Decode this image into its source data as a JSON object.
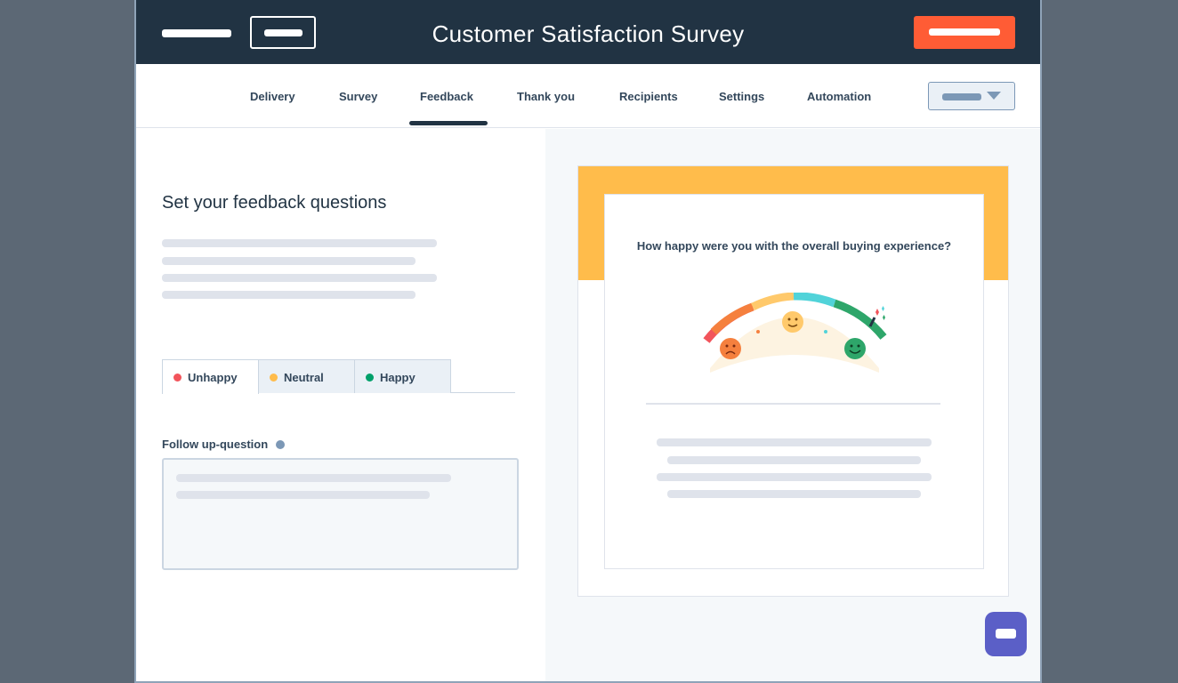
{
  "header": {
    "title": "Customer Satisfaction Survey"
  },
  "tabs": [
    {
      "label": "Delivery"
    },
    {
      "label": "Survey"
    },
    {
      "label": "Feedback",
      "active": true
    },
    {
      "label": "Thank you"
    },
    {
      "label": "Recipients"
    },
    {
      "label": "Settings"
    },
    {
      "label": "Automation"
    }
  ],
  "editor": {
    "section_title": "Set your feedback questions",
    "mood_tabs": [
      {
        "label": "Unhappy",
        "dot_color": "#f2545b",
        "active": true
      },
      {
        "label": "Neutral",
        "dot_color": "#ffbc4b"
      },
      {
        "label": "Happy",
        "dot_color": "#00a06a"
      }
    ],
    "follow_up_label": "Follow up-question"
  },
  "preview": {
    "question": "How happy were you with the overall buying experience?",
    "band_color": "#ffbc4b",
    "gauge_icons": [
      "sad-face-icon",
      "neutral-face-icon",
      "happy-face-icon"
    ]
  },
  "colors": {
    "header_bg": "#213343",
    "cta": "#ff5c35",
    "chat": "#5b5fc7"
  }
}
